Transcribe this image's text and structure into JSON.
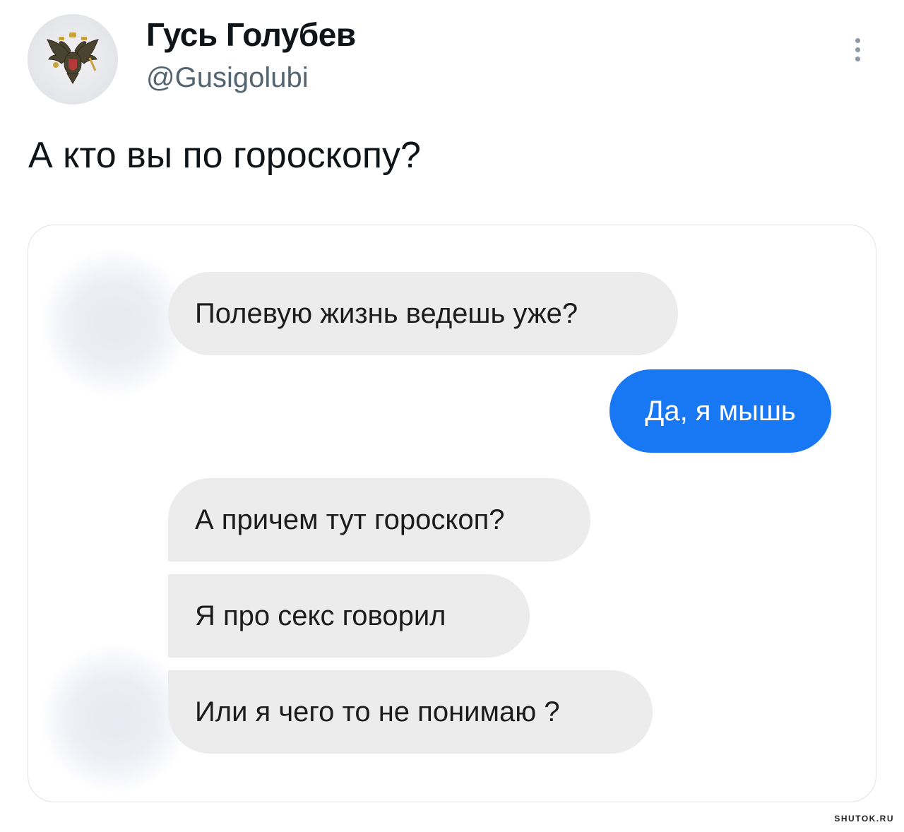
{
  "tweet": {
    "author": {
      "display_name": "Гусь Голубев",
      "handle": "@Gusigolubi",
      "avatar_icon": "double-headed-eagle-emblem"
    },
    "more_icon": "vertical-ellipsis-icon",
    "text": "А кто вы по гороскопу?"
  },
  "chat": {
    "messages": [
      {
        "direction": "incoming",
        "text": "Полевую жизнь ведешь уже?"
      },
      {
        "direction": "outgoing",
        "text": "Да, я мышь"
      },
      {
        "direction": "incoming",
        "text": "А причем тут гороскоп?"
      },
      {
        "direction": "incoming",
        "text": "Я про секс говорил"
      },
      {
        "direction": "incoming",
        "text": "Или я чего то не понимаю ?"
      }
    ],
    "colors": {
      "incoming_bubble": "#ececec",
      "outgoing_bubble": "#1877f2",
      "outgoing_text": "#ffffff"
    }
  },
  "watermark": "SHUTOK.RU"
}
